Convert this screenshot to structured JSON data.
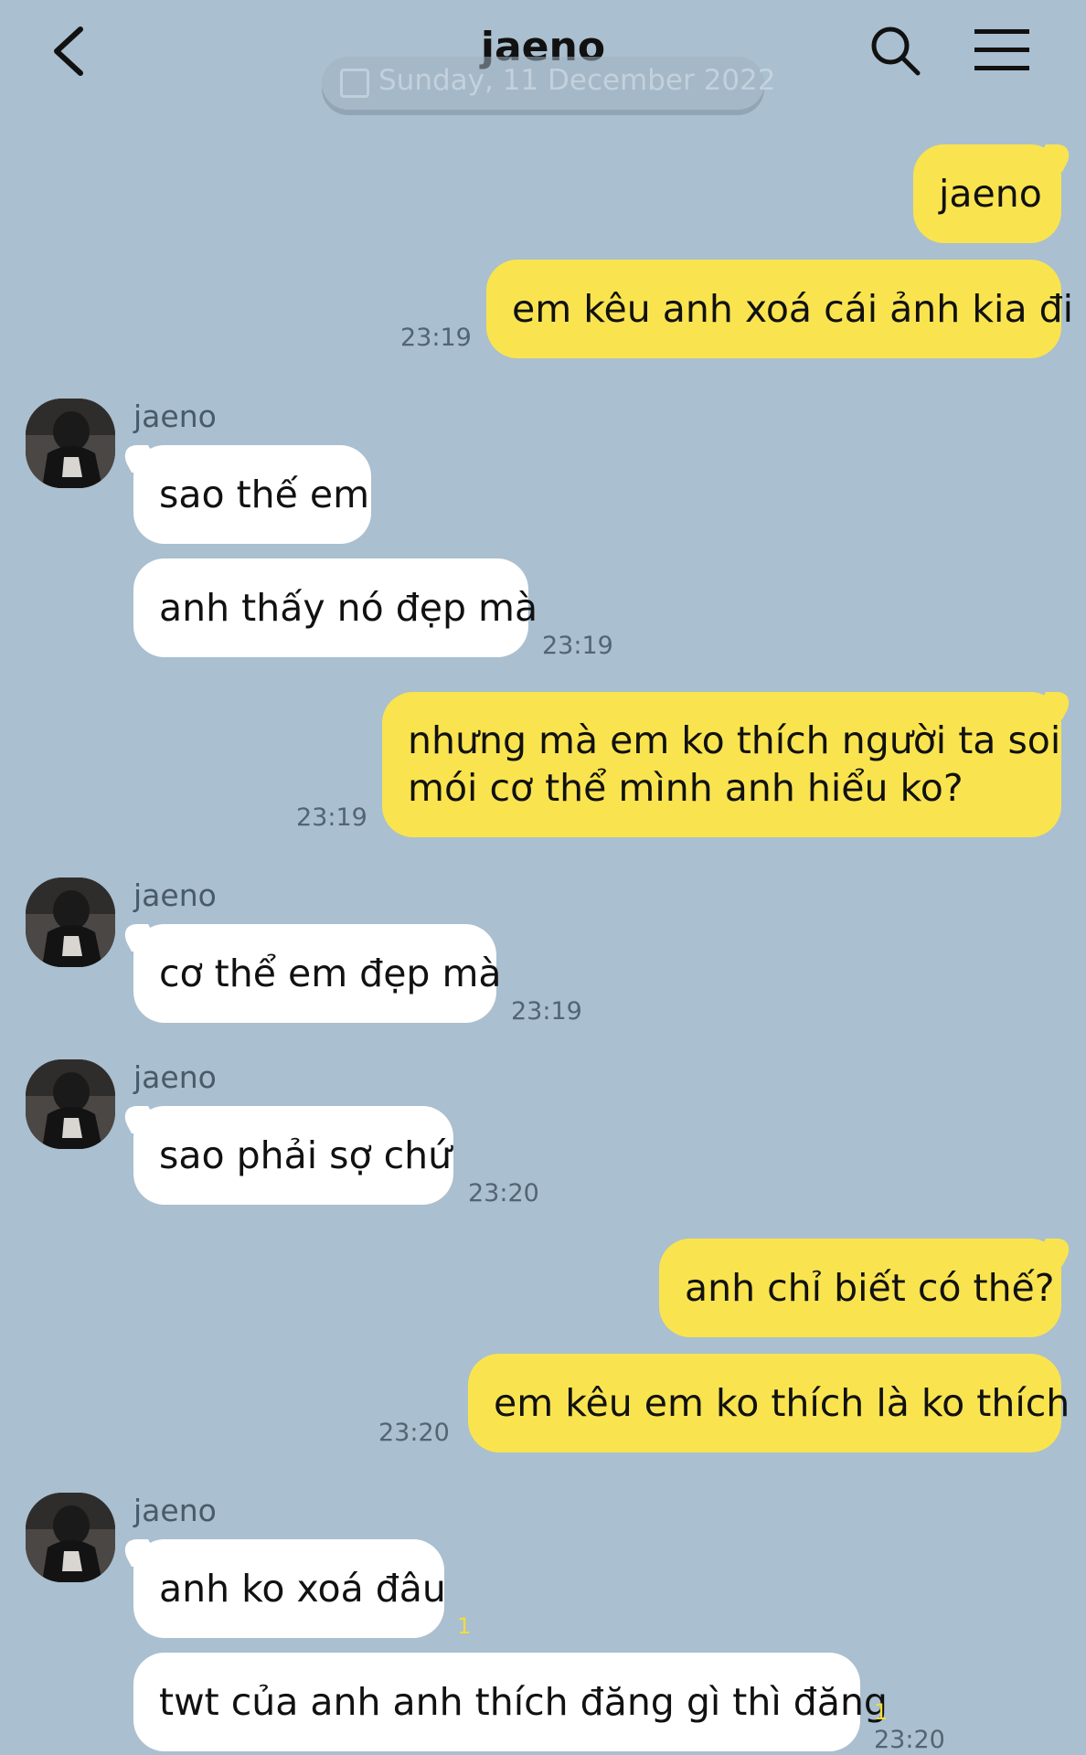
{
  "header": {
    "title": "jaeno"
  },
  "date_divider": "Sunday, 11 December 2022",
  "messages": [
    {
      "text": "jaeno"
    },
    {
      "text": "em kêu anh xoá cái ảnh kia đi",
      "time": "23:19"
    },
    {
      "sender": "jaeno",
      "text": "sao thế em"
    },
    {
      "text": "anh thấy nó đẹp mà",
      "time": "23:19"
    },
    {
      "text_line1": "nhưng mà em ko thích người ta soi",
      "text_line2": "mói cơ thể mình anh hiểu ko?",
      "time": "23:19"
    },
    {
      "sender": "jaeno",
      "text": "cơ thể em đẹp mà",
      "time": "23:19"
    },
    {
      "sender": "jaeno",
      "text": "sao phải sợ chứ",
      "time": "23:20"
    },
    {
      "text": "anh chỉ biết có thế?"
    },
    {
      "text": "em kêu em ko thích là ko thích",
      "time": "23:20"
    },
    {
      "sender": "jaeno",
      "text": "anh ko xoá đâu",
      "unread": "1"
    },
    {
      "text": "twt của anh anh thích đăng gì thì đăng",
      "unread": "1",
      "time": "23:20"
    }
  ]
}
